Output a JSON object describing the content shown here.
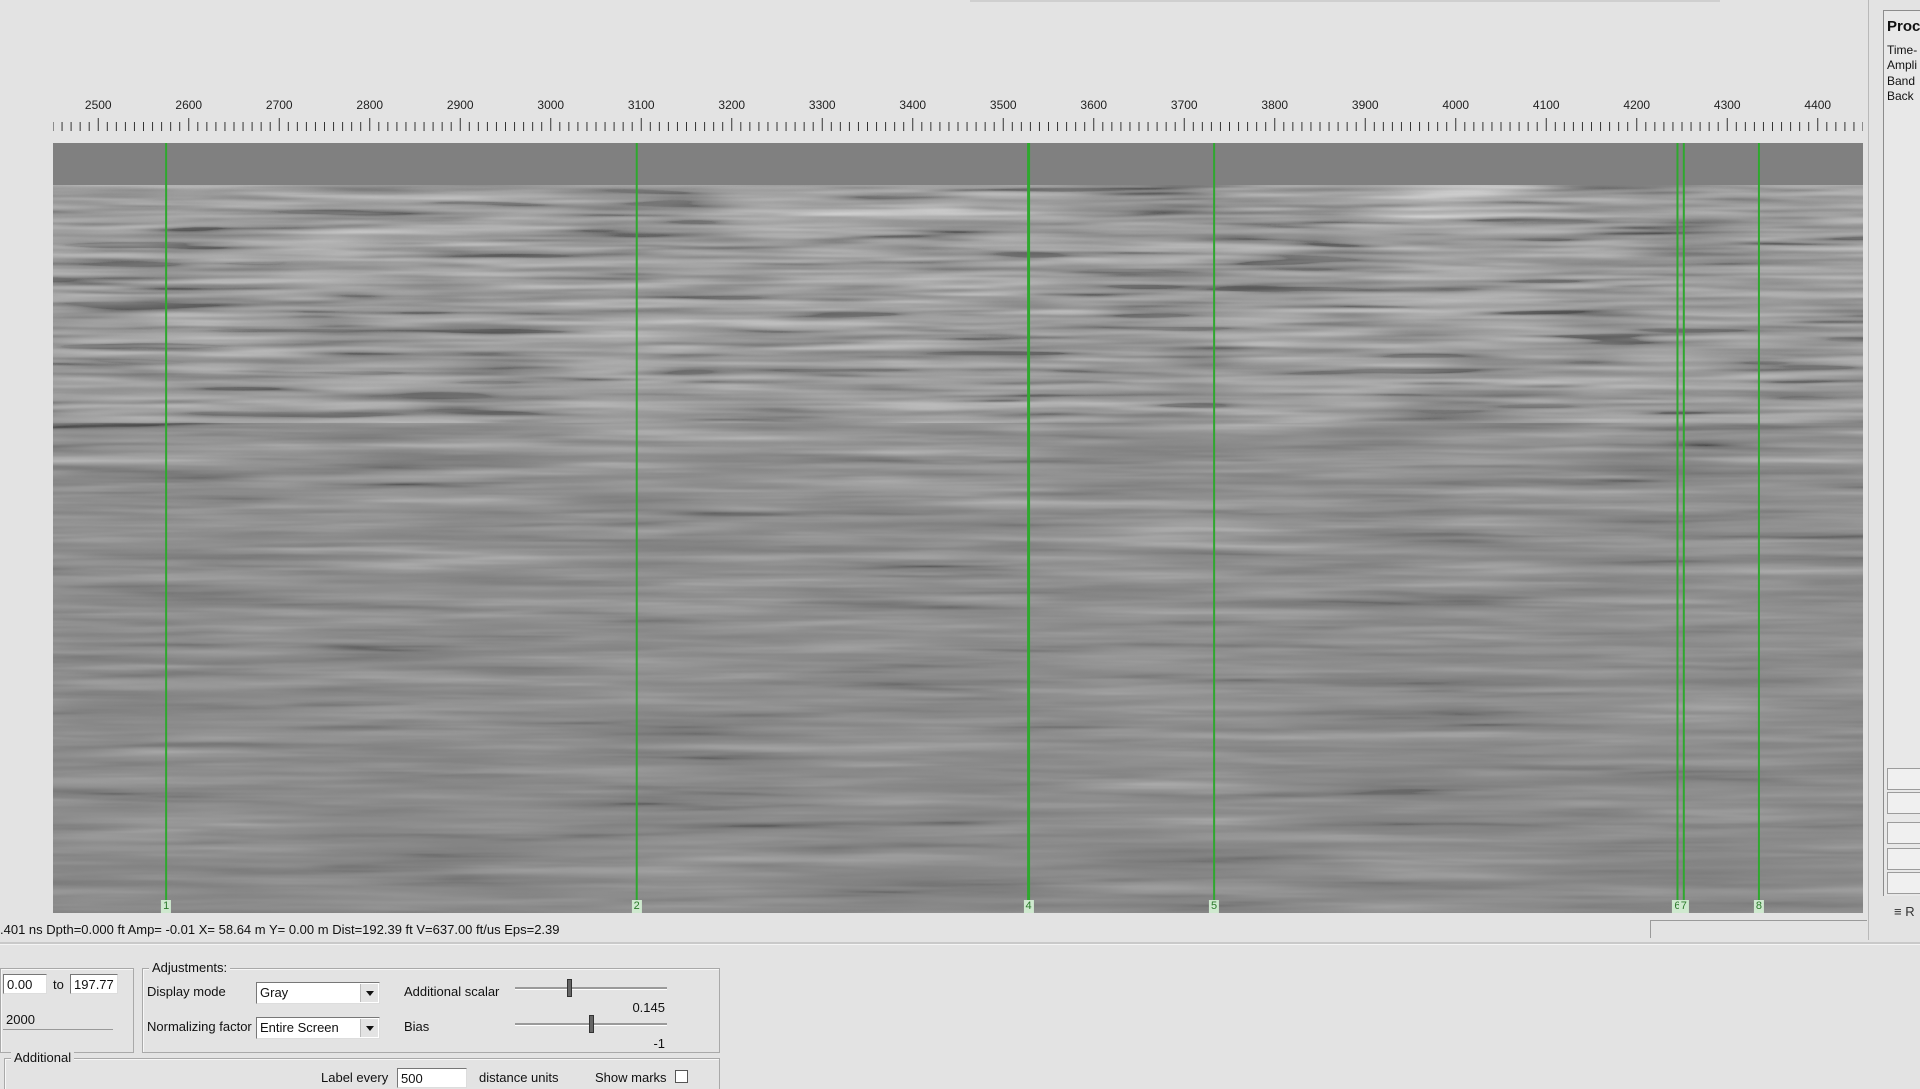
{
  "ruler": {
    "start": 2450,
    "end": 4450,
    "labels": [
      "2500",
      "2600",
      "2700",
      "2800",
      "2900",
      "3000",
      "3100",
      "3200",
      "3300",
      "3400",
      "3500",
      "3600",
      "3700",
      "3800",
      "3900",
      "4000",
      "4100",
      "4200",
      "4300",
      "4400"
    ]
  },
  "markers": [
    {
      "label": "1",
      "position": 2575
    },
    {
      "label": "2",
      "position": 3095
    },
    {
      "label": "4",
      "position": 3528
    },
    {
      "label": "5",
      "position": 3733
    },
    {
      "label": "6",
      "position": 4245
    },
    {
      "label": "7",
      "position": 4252
    },
    {
      "label": "8",
      "position": 4335
    }
  ],
  "colors": {
    "background": "#e3e3e3",
    "radargram": "#808080",
    "marker": "#2ea82e"
  },
  "status": {
    "text": ".401 ns  Dpth=0.000 ft  Amp= -0.01  X= 58.64 m  Y=  0.00 m  Dist=192.39 ft V=637.00 ft/us Eps=2.39"
  },
  "right_panel": {
    "title": "Proc",
    "items": [
      "Time-",
      "Ampli",
      "Band",
      "Back"
    ],
    "list_icon": "list-icon",
    "list_text": "R"
  },
  "range": {
    "from": "0.00",
    "to_label": "to",
    "to": "197.77",
    "count": "2000"
  },
  "adjustments": {
    "legend": "Adjustments:",
    "display_mode_label": "Display mode",
    "display_mode_value": "Gray",
    "normalizing_label": "Normalizing factor",
    "normalizing_value": "Entire Screen",
    "scalar_label": "Additional scalar",
    "scalar_value": "0.145",
    "scalar_level": 0.35,
    "bias_label": "Bias",
    "bias_value": "-1",
    "bias_level": 0.5
  },
  "additional": {
    "legend": "Additional",
    "label_every": "Label every",
    "label_every_value": "500",
    "distance_units": "distance units",
    "show_marks": "Show marks"
  }
}
